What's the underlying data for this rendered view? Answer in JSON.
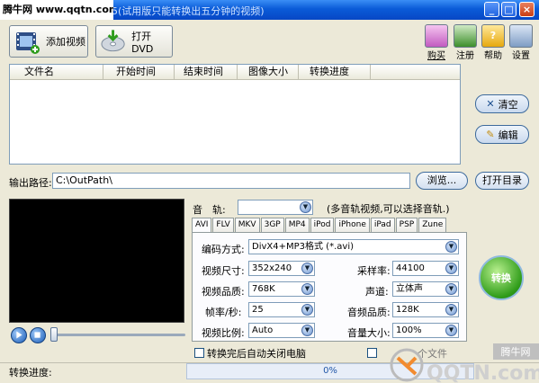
{
  "window": {
    "title": "5(试用版只能转换出五分钟的视频)",
    "watermark": "腾牛网 www.qqtn.com",
    "minimize": "_",
    "maximize": "□",
    "close": "×"
  },
  "toolbar": {
    "add_video": "添加视频",
    "open_dvd": "打开DVD",
    "buy": "购买",
    "register": "注册",
    "help": "帮助",
    "settings": "设置"
  },
  "filelist": {
    "columns": [
      "文件名",
      "开始时间",
      "结束时间",
      "图像大小",
      "转换进度"
    ]
  },
  "side": {
    "clear": "清空",
    "edit": "编辑",
    "open_dir": "打开目录"
  },
  "output": {
    "label": "输出路径:",
    "value": "C:\\OutPath\\",
    "browse": "浏览..."
  },
  "audio": {
    "label": "音　轨:",
    "hint": "(多音轨视频,可以选择音轨.)"
  },
  "tabs": [
    "AVI",
    "FLV",
    "MKV",
    "3GP",
    "MP4",
    "iPod",
    "iPhone",
    "iPad",
    "PSP",
    "Zune"
  ],
  "settings": {
    "encode_label": "编码方式:",
    "encode_value": "DivX4+MP3格式 (*.avi)",
    "size_label": "视频尺寸:",
    "size_value": "352x240",
    "samplerate_label": "采样率:",
    "samplerate_value": "44100",
    "quality_label": "视频品质:",
    "quality_value": "768K",
    "channel_label": "声道:",
    "channel_value": "立体声",
    "fps_label": "帧率/秒:",
    "fps_value": "25",
    "audio_quality_label": "音频品质:",
    "audio_quality_value": "128K",
    "ratio_label": "视频比例:",
    "ratio_value": "Auto",
    "volume_label": "音量大小:",
    "volume_value": "100%"
  },
  "convert": "转换",
  "options": {
    "shutdown": "转换完后自动关闭电脑",
    "file_partial": "个文件"
  },
  "status": {
    "label": "转换进度:",
    "progress": "0%",
    "progress_fraction": 0
  },
  "watermark_logo": {
    "brand": "腾牛网",
    "site": "QQTN.com"
  },
  "colors": {
    "title_blue": "#0a5bd8",
    "panel_bg": "#ece9d8",
    "convert_green": "#2f9c19"
  }
}
